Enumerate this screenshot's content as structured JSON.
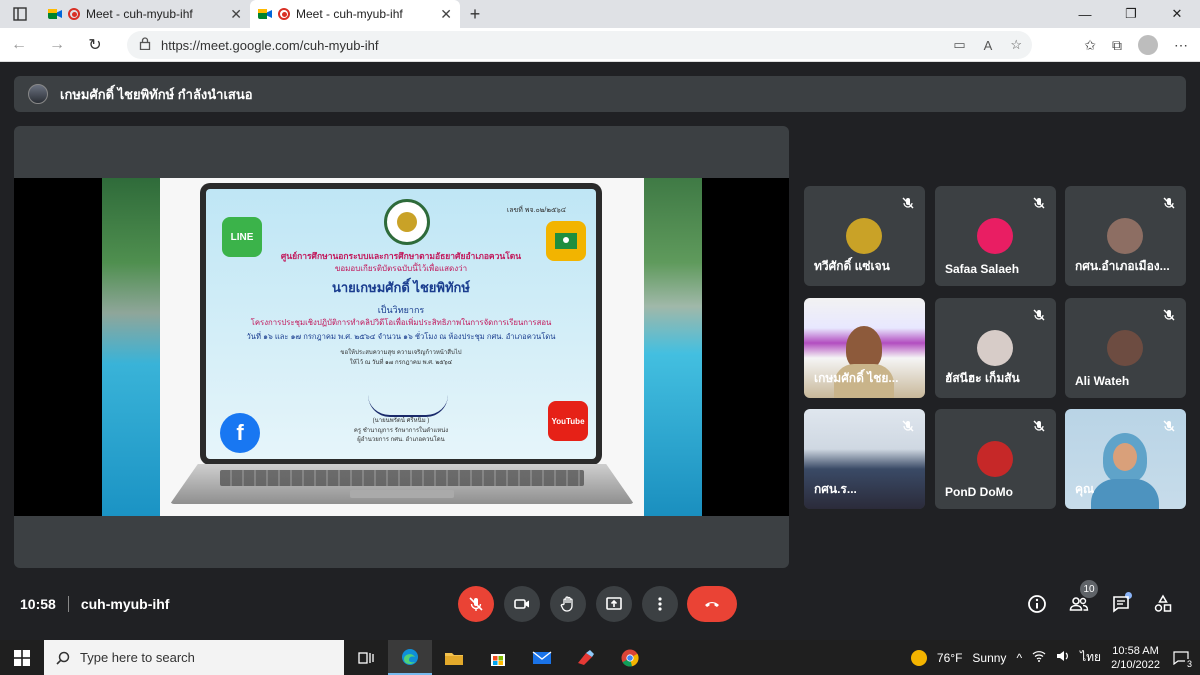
{
  "browser": {
    "tabs": [
      {
        "title": "Meet - cuh-myub-ihf",
        "active": false
      },
      {
        "title": "Meet - cuh-myub-ihf",
        "active": true
      }
    ],
    "url": "https://meet.google.com/cuh-myub-ihf"
  },
  "meet": {
    "presenting_text": "เกษมศักดิ์ ไชยพิทักษ์ กำลังนำเสนอ",
    "meeting_code": "cuh-myub-ihf",
    "time": "10:58",
    "participant_count": "10",
    "certificate": {
      "number": "เลขที่ พจ.๐๒/๒๕๖๔",
      "line1": "ศูนย์การศึกษานอกระบบและการศึกษาตามอัธยาศัยอำเภอควนโดน",
      "line2": "ขอมอบเกียรติบัตรฉบับนี้ไว้เพื่อแสดงว่า",
      "name": "นายเกษมศักดิ์ ไชยพิทักษ์",
      "role": "เป็นวิทยากร",
      "line3": "โครงการประชุมเชิงปฏิบัติการทำคลิปวิดีโอเพื่อเพิ่มประสิทธิภาพในการจัดการเรียนการสอน",
      "line4": "วันที่ ๑๖ และ ๑๗ กรกฎาคม พ.ศ. ๒๕๖๔ จำนวน ๑๖ ชั่วโมง ณ ห้องประชุม กศน. อำเภอควนโดน",
      "line5": "ขอให้ประสบความสุข ความเจริญก้าวหน้าสืบไป",
      "line6": "ให้ไว้ ณ วันที่ ๑๗ กรกฎาคม พ.ศ. ๒๕๖๔",
      "signer": "(นายนพรัตน์ ศรีหนิ่ม )",
      "signer_title1": "ครู ชำนาญการ รักษาการในตำแหน่ง",
      "signer_title2": "ผู้อำนวยการ กศน. อำเภอควนโดน",
      "apps": {
        "line": "LINE",
        "youtube": "YouTube",
        "facebook": "f"
      }
    },
    "participants": [
      {
        "name": "ทวีศักดิ์ แซ่เจน",
        "avatar_color": "#c9a227"
      },
      {
        "name": "Safaa Salaeh",
        "avatar_color": "#e91e63"
      },
      {
        "name": "กศน.อำเภอเมือง...",
        "avatar_color": "#8d6e63"
      },
      {
        "name": "เกษมศักดิ์ ไชย...",
        "video": true
      },
      {
        "name": "ฮัสนีฮะ เก็มสัน",
        "avatar_color": "#d7ccc8"
      },
      {
        "name": "Ali Wateh",
        "avatar_color": "#6d4c41"
      },
      {
        "name": "กศน.ร...",
        "video": true
      },
      {
        "name": "PonD DoMo",
        "avatar_color": "#c62828"
      },
      {
        "name": "คุณ",
        "video": true
      }
    ]
  },
  "taskbar": {
    "search_placeholder": "Type here to search",
    "weather_temp": "76°F",
    "weather_desc": "Sunny",
    "lang": "ไทย",
    "clock_time": "10:58 AM",
    "clock_date": "2/10/2022",
    "notif_count": "3"
  }
}
